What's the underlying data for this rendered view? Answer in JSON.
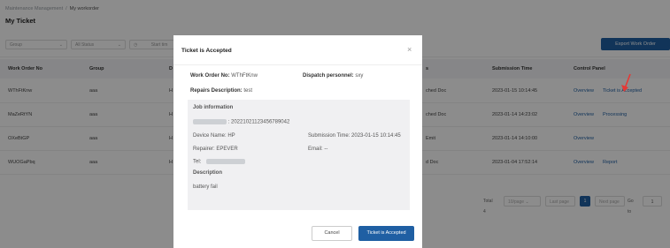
{
  "breadcrumb": {
    "parent": "Maintenance Management",
    "separator": "/",
    "current": "My workorder"
  },
  "page_title": "My Ticket",
  "filters": {
    "group_placeholder": "Group",
    "status_value": "All Status",
    "start_placeholder": "Start tim"
  },
  "export_label": "Export Work Order",
  "table": {
    "headers": {
      "order_no": "Work Order No",
      "group": "Group",
      "device": "D",
      "status": "s",
      "submission": "Submission Time",
      "control": "Control Panel"
    },
    "rows": [
      {
        "order_no": "WThFtKnw",
        "group": "aaa",
        "device": "H",
        "status": "ched Doc",
        "submission": "2023-01-15 10:14:45",
        "actions": [
          "Overview",
          "Ticket is Accepted"
        ]
      },
      {
        "order_no": "MaZeRtYN",
        "group": "aaa",
        "device": "H",
        "status": "ched Doc",
        "submission": "2023-01-14 14:23:02",
        "actions": [
          "Overview",
          "Processing"
        ]
      },
      {
        "order_no": "OXeBtGP",
        "group": "aaa",
        "device": "H",
        "status": "Emit",
        "submission": "2023-01-14 14:10:00",
        "actions": [
          "Overview"
        ]
      },
      {
        "order_no": "WUOGaPbq",
        "group": "aaa",
        "device": "H",
        "status": "d Doc",
        "submission": "2023-01-04 17:52:14",
        "actions": [
          "Overview",
          "Report"
        ]
      }
    ]
  },
  "pagination": {
    "total": "Total 4",
    "page_size": "10/page",
    "prev": "Last page",
    "current": "1",
    "next": "Next page",
    "goto": "Go to",
    "goto_value": "1"
  },
  "modal": {
    "title": "Ticket is Accepted",
    "close_glyph": "×",
    "work_order_label": "Work Order No:",
    "work_order_value": "WThFtKnw",
    "dispatch_label": "Dispatch personnel:",
    "dispatch_value": "sxy",
    "repairs_label": "Repairs Description:",
    "repairs_value": "test",
    "job": {
      "heading": "Job information",
      "id_value": ": 20221021123456789042",
      "device": "Device Name:  HP",
      "submission": "Submission Time:  2023-01-15 10:14:45",
      "repairer": "Repairer:  EPEVER",
      "email": "Email:  --",
      "tel": "Tel:",
      "description_heading": "Description",
      "description_value": "battery fail"
    },
    "cancel_label": "Cancel",
    "accept_label": "Ticket is Accepted"
  },
  "colors": {
    "primary": "#1f5fa3",
    "arrow": "#e53935",
    "overlay": "rgba(0,0,0,0.45)"
  }
}
